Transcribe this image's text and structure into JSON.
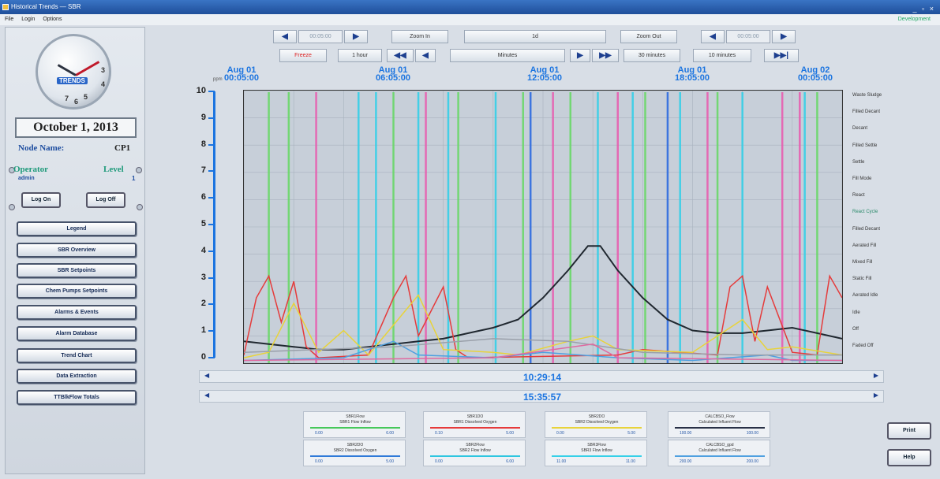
{
  "window": {
    "title": "Historical Trends — SBR",
    "controls": "_ ▫ ×"
  },
  "menu": {
    "items": [
      "File",
      "Login",
      "Options"
    ],
    "right": "Development"
  },
  "clock": {
    "numbers": [
      "7",
      "6",
      "5",
      "4",
      "3"
    ],
    "logo": "TRENDS"
  },
  "date": "October 1, 2013",
  "node": {
    "label": "Node Name:",
    "value": "CP1"
  },
  "operator": {
    "label": "Operator",
    "value": "admin",
    "level_label": "Level",
    "level_value": "1"
  },
  "login_buttons": {
    "log_on": "Log On",
    "log_off": "Log Off"
  },
  "nav": [
    "Legend",
    "SBR Overview",
    "SBR Setpoints",
    "Chem Pumps Setpoints",
    "Alarms & Events",
    "Alarm Database",
    "Trend Chart",
    "Data Extraction",
    "TTBlkFlow Totals"
  ],
  "toolbar1": {
    "start_time": "00:05:00",
    "zoom_in": "Zoom In",
    "zoom_value": "1d",
    "zoom_out": "Zoom Out",
    "end_time": "00:05:00"
  },
  "toolbar2": {
    "freeze": "Freeze",
    "hour": "1 hour",
    "minutes": "Minutes",
    "thirty": "30 minutes",
    "ten": "10 minutes"
  },
  "arrows": {
    "left": "◀",
    "right": "▶",
    "fast_left": "◀◀",
    "fast_right": "▶▶",
    "end": "▶▶|"
  },
  "units": "ppm",
  "time_cursor_1": "10:29:14",
  "time_cursor_2": "15:35:57",
  "right_legend": [
    "Waste Sludge",
    "Filled Decant",
    "Decant",
    "Filled Settle",
    "Settle",
    "Fill Mode",
    "React",
    "React Cycle",
    "Filled Decant",
    "Aerated Fill",
    "Mixed Fill",
    "Static Fill",
    "Aerated Idle",
    "Idle",
    "Off",
    "Faded Off"
  ],
  "cards": [
    {
      "name": "SBR1Flow",
      "desc": "SBR1 Flow Inflow",
      "color": "#46c85a",
      "v1": "0.00",
      "v2": "6.00"
    },
    {
      "name": "SBR1DO",
      "desc": "SBR1 Dissolved Oxygen",
      "color": "#e63a3a",
      "v1": "0.10",
      "v2": "5.00"
    },
    {
      "name": "SBR2DO",
      "desc": "SBR2 Dissolved Oxygen",
      "color": "#e8d33a",
      "v1": "0.00",
      "v2": "5.00"
    },
    {
      "name": "CALCBSO_Flow",
      "desc": "Calculated Influent Flow",
      "color": "#283046",
      "v1": "100.00",
      "v2": "100.00"
    },
    {
      "name": "SBR2DO",
      "desc": "SBR2 Dissolved Oxygen",
      "color": "#2f7ad8",
      "v1": "0.00",
      "v2": "5.00"
    },
    {
      "name": "SBR2Flow",
      "desc": "SBR2 Flow Inflow",
      "color": "#2ec6e0",
      "v1": "0.00",
      "v2": "6.00"
    },
    {
      "name": "SBR3Flow",
      "desc": "SBR3 Flow Inflow",
      "color": "#35d0e8",
      "v1": "11.00",
      "v2": "11.00"
    },
    {
      "name": "CALCBSO_gpd",
      "desc": "Calculated Influent Flow",
      "color": "#4fa0e0",
      "v1": "200.00",
      "v2": "200.00"
    }
  ],
  "side_buttons": {
    "print": "Print",
    "help": "Help"
  },
  "chart_data": {
    "type": "line",
    "ylabel": "ppm",
    "ylim": [
      0,
      10
    ],
    "yticks": [
      "10",
      "9",
      "8",
      "7",
      "6",
      "5",
      "4",
      "3",
      "2",
      "1",
      "0"
    ],
    "x_labels": [
      {
        "date": "Aug 01",
        "time": "00:05:00"
      },
      {
        "date": "Aug 01",
        "time": "06:05:00"
      },
      {
        "date": "Aug 01",
        "time": "12:05:00"
      },
      {
        "date": "Aug 01",
        "time": "18:05:00"
      },
      {
        "date": "Aug 02",
        "time": "00:05:00"
      }
    ],
    "xlim_hours": [
      0,
      24
    ],
    "grid": true,
    "series": [
      {
        "color": "#202830",
        "points": [
          [
            0,
            0.8
          ],
          [
            1,
            0.7
          ],
          [
            2,
            0.6
          ],
          [
            3,
            0.5
          ],
          [
            4,
            0.5
          ],
          [
            5,
            0.6
          ],
          [
            6,
            0.7
          ],
          [
            7,
            0.8
          ],
          [
            8,
            0.9
          ],
          [
            9,
            1.1
          ],
          [
            10,
            1.3
          ],
          [
            11,
            1.6
          ],
          [
            12,
            2.4
          ],
          [
            13,
            3.4
          ],
          [
            13.8,
            4.3
          ],
          [
            14.3,
            4.3
          ],
          [
            15,
            3.4
          ],
          [
            16,
            2.4
          ],
          [
            17,
            1.6
          ],
          [
            18,
            1.2
          ],
          [
            19,
            1.1
          ],
          [
            20,
            1.1
          ],
          [
            21,
            1.2
          ],
          [
            22,
            1.3
          ],
          [
            23,
            1.1
          ],
          [
            24,
            0.9
          ]
        ]
      },
      {
        "color": "#e53b3b",
        "points": [
          [
            0,
            0.3
          ],
          [
            0.5,
            2.4
          ],
          [
            1,
            3.2
          ],
          [
            1.5,
            1.5
          ],
          [
            2,
            3.0
          ],
          [
            2.5,
            0.6
          ],
          [
            3,
            0.2
          ],
          [
            5,
            0.3
          ],
          [
            6,
            2.4
          ],
          [
            6.5,
            3.2
          ],
          [
            7,
            1.0
          ],
          [
            8,
            2.8
          ],
          [
            8.5,
            0.5
          ],
          [
            9,
            0.2
          ],
          [
            15,
            0.3
          ],
          [
            16,
            0.5
          ],
          [
            19,
            0.3
          ],
          [
            19.5,
            2.8
          ],
          [
            20,
            3.2
          ],
          [
            20.5,
            0.8
          ],
          [
            21,
            2.8
          ],
          [
            22,
            0.4
          ],
          [
            23,
            0.3
          ],
          [
            23.5,
            3.2
          ],
          [
            24,
            2.4
          ]
        ]
      },
      {
        "color": "#e8d33a",
        "points": [
          [
            0,
            0.2
          ],
          [
            1,
            0.4
          ],
          [
            2,
            2.2
          ],
          [
            3,
            0.4
          ],
          [
            4,
            1.2
          ],
          [
            5,
            0.3
          ],
          [
            7,
            2.5
          ],
          [
            8,
            0.5
          ],
          [
            10,
            0.4
          ],
          [
            11,
            0.3
          ],
          [
            13,
            0.8
          ],
          [
            14,
            1.0
          ],
          [
            15,
            0.5
          ],
          [
            18,
            0.4
          ],
          [
            20,
            1.6
          ],
          [
            21,
            0.5
          ],
          [
            22,
            0.6
          ],
          [
            24,
            0.3
          ]
        ]
      },
      {
        "color": "#4fa0e0",
        "points": [
          [
            0,
            0.1
          ],
          [
            4,
            0.2
          ],
          [
            6,
            0.8
          ],
          [
            7,
            0.3
          ],
          [
            10,
            0.2
          ],
          [
            12,
            0.4
          ],
          [
            15,
            0.2
          ],
          [
            18,
            0.1
          ],
          [
            21,
            0.3
          ],
          [
            22,
            0.1
          ],
          [
            24,
            0.1
          ]
        ]
      },
      {
        "color": "#9aa0aa",
        "points": [
          [
            0,
            0.4
          ],
          [
            6,
            0.6
          ],
          [
            10,
            0.9
          ],
          [
            13,
            0.8
          ],
          [
            16,
            0.4
          ],
          [
            20,
            0.3
          ],
          [
            24,
            0.3
          ]
        ]
      },
      {
        "color": "#e06aa0",
        "points": [
          [
            0,
            0.1
          ],
          [
            10,
            0.2
          ],
          [
            14,
            0.7
          ],
          [
            15,
            0.2
          ],
          [
            24,
            0.1
          ]
        ]
      }
    ],
    "spikes": [
      {
        "color": "#e85fb0",
        "x": [
          2.9,
          7.3,
          12.4,
          15.0,
          18.6,
          21.6,
          22.3
        ]
      },
      {
        "color": "#35d0e8",
        "x": [
          4.6,
          5.3,
          7.0,
          8.2,
          10.1,
          14.2,
          15.6,
          17.5,
          20.0,
          22.5
        ]
      },
      {
        "color": "#6ad86a",
        "x": [
          1.0,
          1.8,
          6.0,
          8.6,
          11.2,
          13.1,
          16.1,
          19.0,
          23.0
        ]
      },
      {
        "color": "#2f6ce0",
        "x": [
          11.5,
          17.0
        ]
      }
    ]
  }
}
